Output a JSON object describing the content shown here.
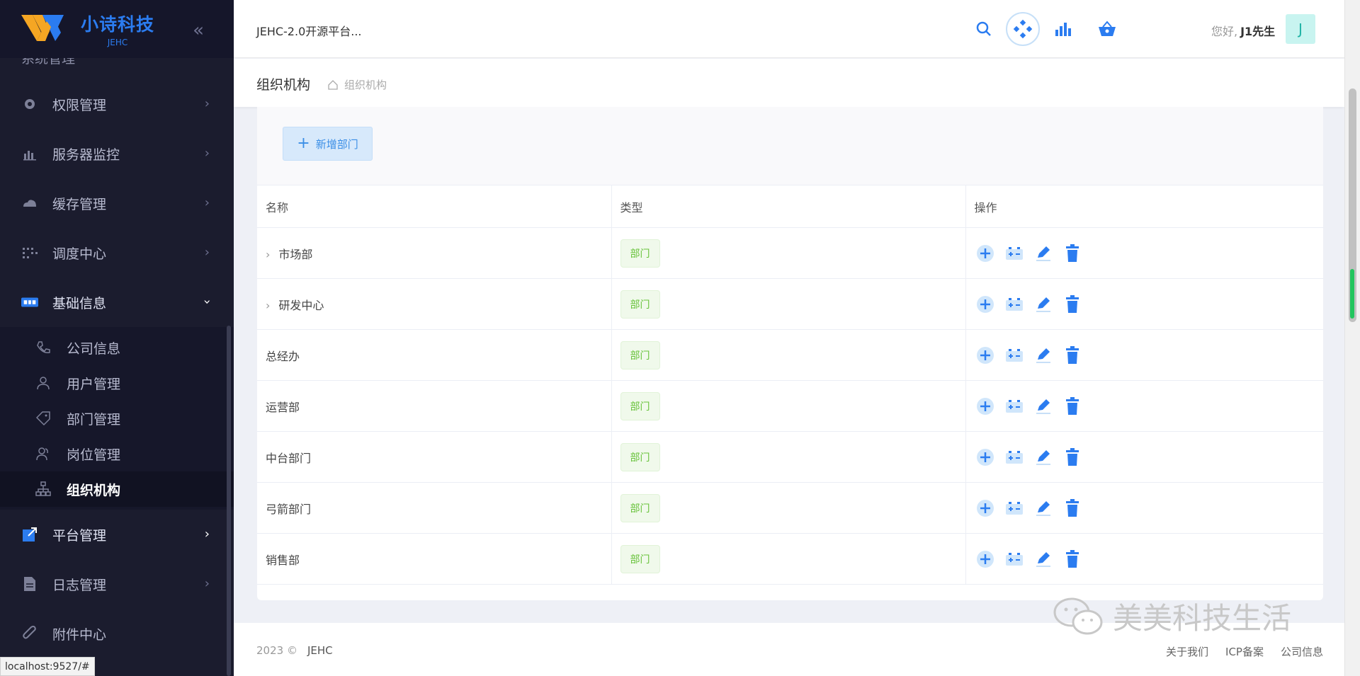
{
  "brand": {
    "title": "小诗科技",
    "subtitle": "JEHC"
  },
  "sidebar": {
    "partial_item": "系统管理",
    "items": [
      {
        "label": "权限管理",
        "icon": "gear-icon"
      },
      {
        "label": "服务器监控",
        "icon": "bar-chart-icon"
      },
      {
        "label": "缓存管理",
        "icon": "cloud-icon"
      },
      {
        "label": "调度中心",
        "icon": "grid-icon"
      },
      {
        "label": "基础信息",
        "icon": "card-icon",
        "expanded": true
      }
    ],
    "sub_items": [
      {
        "label": "公司信息",
        "icon": "phone-icon"
      },
      {
        "label": "用户管理",
        "icon": "user-icon"
      },
      {
        "label": "部门管理",
        "icon": "tag-icon"
      },
      {
        "label": "岗位管理",
        "icon": "users-icon"
      },
      {
        "label": "组织机构",
        "icon": "org-icon",
        "selected": true
      }
    ],
    "bottom_items": [
      {
        "label": "平台管理",
        "icon": "export-icon"
      },
      {
        "label": "日志管理",
        "icon": "file-icon"
      },
      {
        "label": "附件中心",
        "icon": "paperclip-icon"
      }
    ]
  },
  "header": {
    "title": "JEHC-2.0开源平台...",
    "greeting": "您好,",
    "username": "J1先生",
    "avatar_letter": "J"
  },
  "page": {
    "title": "组织机构",
    "breadcrumb": "组织机构"
  },
  "toolbar": {
    "add_label": "新增部门"
  },
  "table": {
    "columns": [
      "名称",
      "类型",
      "操作"
    ],
    "rows": [
      {
        "name": "市场部",
        "type": "部门",
        "expandable": true
      },
      {
        "name": "研发中心",
        "type": "部门",
        "expandable": true
      },
      {
        "name": "总经办",
        "type": "部门",
        "expandable": false
      },
      {
        "name": "运营部",
        "type": "部门",
        "expandable": false
      },
      {
        "name": "中台部门",
        "type": "部门",
        "expandable": false
      },
      {
        "name": "弓箭部门",
        "type": "部门",
        "expandable": false
      },
      {
        "name": "销售部",
        "type": "部门",
        "expandable": false
      }
    ]
  },
  "footer": {
    "year": "2023 ©",
    "brand": "JEHC",
    "links": [
      "关于我们",
      "ICP备案",
      "公司信息"
    ]
  },
  "watermark": "美美科技生活",
  "status_url": "localhost:9527/#",
  "colors": {
    "accent": "#2b7cf0",
    "sidebar_bg": "#1b1c2e",
    "tag_green": "#67c23a"
  }
}
